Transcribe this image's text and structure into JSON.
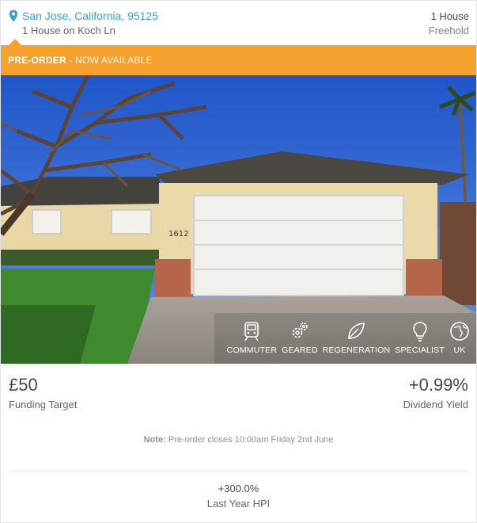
{
  "header": {
    "location": "San Jose, California, 95125",
    "subtitle": "1 House on Koch Ln",
    "count": "1 House",
    "tenure": "Freehold",
    "location_color": "#3aa0d8"
  },
  "banner": {
    "strong": "PRE-ORDER",
    "rest": " - NOW AVAILABLE",
    "color": "#f4a22d"
  },
  "photo": {
    "house_number": "1612"
  },
  "tags": [
    {
      "label": "COMMUTER",
      "icon": "train-icon"
    },
    {
      "label": "GEARED",
      "icon": "gears-icon"
    },
    {
      "label": "REGENERATION",
      "icon": "leaf-icon"
    },
    {
      "label": "SPECIALIST",
      "icon": "lightbulb-icon"
    },
    {
      "label": "UK",
      "icon": "globe-icon"
    }
  ],
  "stats": {
    "funding_value": "£50",
    "funding_label": "Funding Target",
    "yield_value": "+0.99%",
    "yield_label": "Dividend Yield"
  },
  "note": {
    "prefix": "Note:",
    "text": " Pre-order closes 10:00am Friday 2nd June"
  },
  "hpi": {
    "value": "+300.0%",
    "label": "Last Year HPI"
  }
}
